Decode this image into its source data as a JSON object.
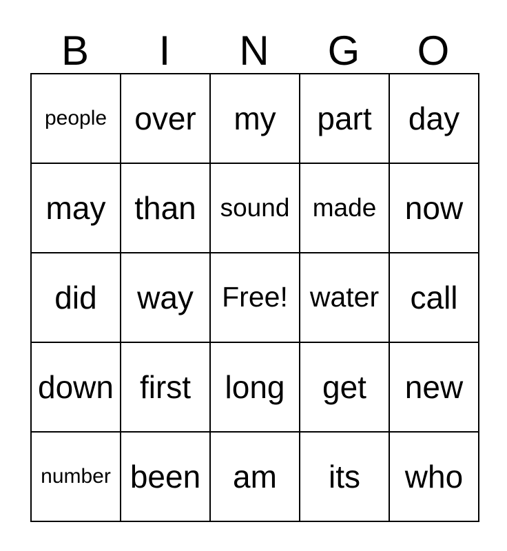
{
  "card": {
    "title_letters": [
      "B",
      "I",
      "N",
      "G",
      "O"
    ],
    "columns": 5,
    "rows": 5,
    "border_color": "#000000",
    "text_color": "#000000",
    "background_color": "#ffffff",
    "free_space": "Free!",
    "free_space_position": {
      "row": 3,
      "column": 3
    },
    "grid": [
      [
        {
          "text": "people",
          "size": "s"
        },
        {
          "text": "over",
          "size": "xl"
        },
        {
          "text": "my",
          "size": "xl"
        },
        {
          "text": "part",
          "size": "xl"
        },
        {
          "text": "day",
          "size": "xl"
        }
      ],
      [
        {
          "text": "may",
          "size": "xl"
        },
        {
          "text": "than",
          "size": "xl"
        },
        {
          "text": "sound",
          "size": "m"
        },
        {
          "text": "made",
          "size": "m"
        },
        {
          "text": "now",
          "size": "xl"
        }
      ],
      [
        {
          "text": "did",
          "size": "xl"
        },
        {
          "text": "way",
          "size": "xl"
        },
        {
          "text": "Free!",
          "size": "l"
        },
        {
          "text": "water",
          "size": "l"
        },
        {
          "text": "call",
          "size": "xl"
        }
      ],
      [
        {
          "text": "down",
          "size": "xl"
        },
        {
          "text": "first",
          "size": "xl"
        },
        {
          "text": "long",
          "size": "xl"
        },
        {
          "text": "get",
          "size": "xl"
        },
        {
          "text": "new",
          "size": "xl"
        }
      ],
      [
        {
          "text": "number",
          "size": "s"
        },
        {
          "text": "been",
          "size": "xl"
        },
        {
          "text": "am",
          "size": "xl"
        },
        {
          "text": "its",
          "size": "xl"
        },
        {
          "text": "who",
          "size": "xl"
        }
      ]
    ]
  }
}
